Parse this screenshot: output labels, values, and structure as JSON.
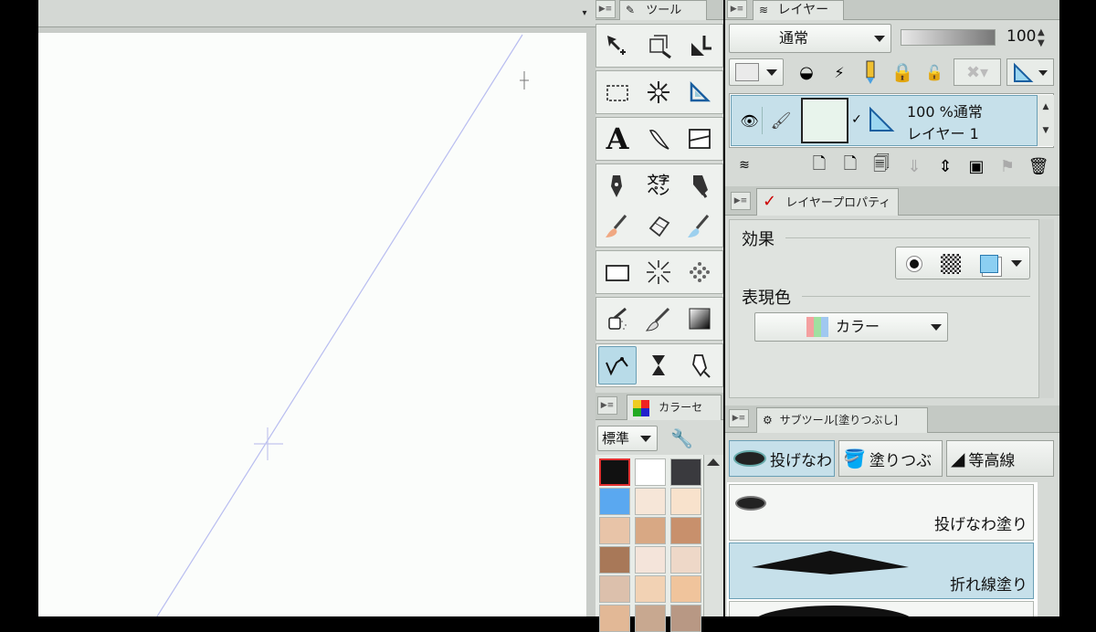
{
  "canvas": {
    "scroll_arrow": "▾"
  },
  "tool_panel": {
    "title": "ツール"
  },
  "layer_panel": {
    "title": "レイヤー",
    "blend_mode": "通常",
    "opacity_value": "100",
    "layer": {
      "info": "100 %通常",
      "name": "レイヤー 1"
    }
  },
  "layer_property": {
    "title": "レイヤープロパティ",
    "effect_label": "効果",
    "expression_label": "表現色",
    "expression_value": "カラー"
  },
  "color_panel": {
    "title": "カラーセ",
    "set_value": "標準",
    "colors": [
      "#111111",
      "#ffffff",
      "#3a3a3e",
      "#5aa8f0",
      "#f6e6d8",
      "#f8e2cc",
      "#e8c4a8",
      "#d8a884",
      "#c8906c",
      "#a87858",
      "#f4e4da",
      "#eed8c8",
      "#dcc0ac",
      "#f2d2b4",
      "#f0c49c",
      "#e2b896",
      "#c8a890",
      "#b89884"
    ]
  },
  "subtool_panel": {
    "title": "サブツール[塗りつぶし]",
    "tabs": [
      "投げなわ",
      "塗りつぶ",
      "等高線"
    ],
    "presets": [
      "投げなわ塗り",
      "折れ線塗り"
    ]
  },
  "tool_icons": {
    "rows": [
      [
        "move-tool",
        "transform-tool",
        "operation-tool"
      ],
      [
        "marquee-tool",
        "auto-select-tool",
        "ruler-tool"
      ],
      [
        "text-tool",
        "balloon-tool",
        "frame-border-tool"
      ],
      [
        "pen-tool",
        "text-pen-tool",
        "marker-tool"
      ],
      [
        "brush-tool",
        "eraser-tool",
        "blend-tool"
      ],
      [
        "figure-tool",
        "speed-line-tool",
        "tone-tool"
      ],
      [
        "airbrush-tool",
        "decoration-tool",
        "gradient-tool"
      ],
      [
        "fill-tool",
        "blur-tool",
        "correct-line-tool"
      ]
    ]
  }
}
